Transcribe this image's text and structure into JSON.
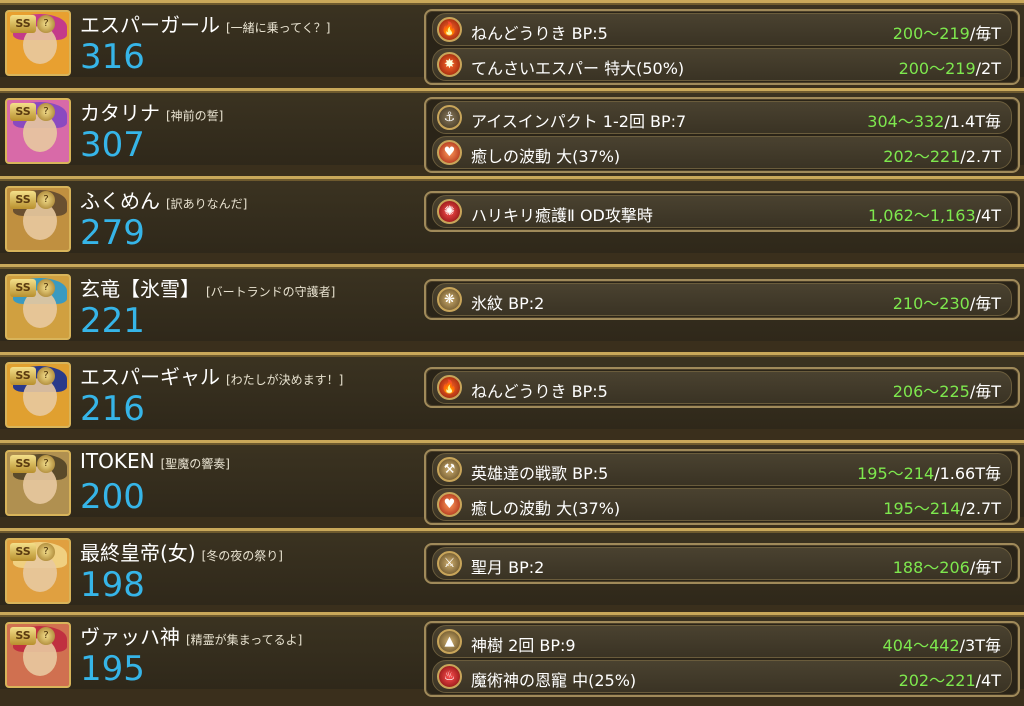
{
  "rows": [
    {
      "name": "エスパーガール",
      "title": "[一緒に乗ってく？]",
      "power": "316",
      "avatar_icon": "esper-girl-portrait-icon",
      "colors": {
        "hair": "#c43a8a",
        "bg": "#e8a030"
      },
      "skills": [
        {
          "icon": "flame-icon",
          "icon_class": "fire",
          "glyph": "🔥",
          "name": "ねんどうりき BP:5",
          "range": "200〜219",
          "unit": "/毎T"
        },
        {
          "icon": "flame-burst-icon",
          "icon_class": "fire",
          "glyph": "✸",
          "name": "てんさいエスパー 特大(50%)",
          "range": "200〜219",
          "unit": "/2T"
        }
      ]
    },
    {
      "name": "カタリナ",
      "title": "[神前の誓]",
      "power": "307",
      "avatar_icon": "katarina-portrait-icon",
      "colors": {
        "hair": "#8a4ac0",
        "bg": "#d86aa8"
      },
      "skills": [
        {
          "icon": "ice-impact-icon",
          "icon_class": "ice",
          "glyph": "⚓",
          "name": "アイスインパクト 1-2回 BP:7",
          "range": "304〜332",
          "unit": "/1.4T毎"
        },
        {
          "icon": "heal-heart-icon",
          "icon_class": "heal",
          "glyph": "♥",
          "name": "癒しの波動 大(37%)",
          "range": "202〜221",
          "unit": "/2.7T"
        }
      ]
    },
    {
      "name": "ふくめん",
      "title": "[訳ありなんだ]",
      "power": "279",
      "avatar_icon": "fukumen-portrait-icon",
      "colors": {
        "hair": "#6a5030",
        "bg": "#c09040"
      },
      "skills": [
        {
          "icon": "heal-burst-icon",
          "icon_class": "crimson",
          "glyph": "✺",
          "name": "ハリキリ癒護Ⅱ OD攻撃時",
          "range": "1,062〜1,163",
          "unit": "/4T"
        }
      ]
    },
    {
      "name": "玄竜【氷雪】",
      "title": "[バートランドの守護者]",
      "power": "221",
      "avatar_icon": "gen-ryu-portrait-icon",
      "colors": {
        "hair": "#3a9ac0",
        "bg": "#d0a040"
      },
      "skills": [
        {
          "icon": "ice-crest-icon",
          "icon_class": "gold",
          "glyph": "❋",
          "name": "氷紋 BP:2",
          "range": "210〜230",
          "unit": "/毎T"
        }
      ]
    },
    {
      "name": "エスパーギャル",
      "title": "[わたしが決めます！]",
      "power": "216",
      "avatar_icon": "esper-gal-portrait-icon",
      "colors": {
        "hair": "#2a3a8a",
        "bg": "#e0a030"
      },
      "skills": [
        {
          "icon": "flame-icon",
          "icon_class": "fire",
          "glyph": "🔥",
          "name": "ねんどうりき BP:5",
          "range": "206〜225",
          "unit": "/毎T"
        }
      ]
    },
    {
      "name": "ITOKEN",
      "title": "[聖魔の響奏]",
      "power": "200",
      "avatar_icon": "itoken-portrait-icon",
      "colors": {
        "hair": "#5a4a2a",
        "bg": "#b09050"
      },
      "skills": [
        {
          "icon": "hammer-icon",
          "icon_class": "gold",
          "glyph": "⚒",
          "name": "英雄達の戦歌 BP:5",
          "range": "195〜214",
          "unit": "/1.66T毎"
        },
        {
          "icon": "heal-heart-icon",
          "icon_class": "heal",
          "glyph": "♥",
          "name": "癒しの波動 大(37%)",
          "range": "195〜214",
          "unit": "/2.7T"
        }
      ]
    },
    {
      "name": "最終皇帝(女)",
      "title": "[冬の夜の祭り]",
      "power": "198",
      "avatar_icon": "final-empress-portrait-icon",
      "colors": {
        "hair": "#f0d080",
        "bg": "#e0a040"
      },
      "skills": [
        {
          "icon": "sword-icon",
          "icon_class": "gold",
          "glyph": "⚔",
          "name": "聖月 BP:2",
          "range": "188〜206",
          "unit": "/毎T"
        }
      ]
    },
    {
      "name": "ヴァッハ神",
      "title": "[精霊が集まってるよ]",
      "power": "195",
      "avatar_icon": "vahha-god-portrait-icon",
      "colors": {
        "hair": "#c03040",
        "bg": "#d07050"
      },
      "skills": [
        {
          "icon": "tree-icon",
          "icon_class": "gold",
          "glyph": "▲",
          "name": "神樹 2回 BP:9",
          "range": "404〜442",
          "unit": "/3T毎"
        },
        {
          "icon": "crimson-flame-icon",
          "icon_class": "crimson",
          "glyph": "♨",
          "name": "魔術神の恩寵 中(25%)",
          "range": "202〜221",
          "unit": "/4T"
        }
      ]
    }
  ],
  "badge_label": "SS",
  "medal_label": "?"
}
